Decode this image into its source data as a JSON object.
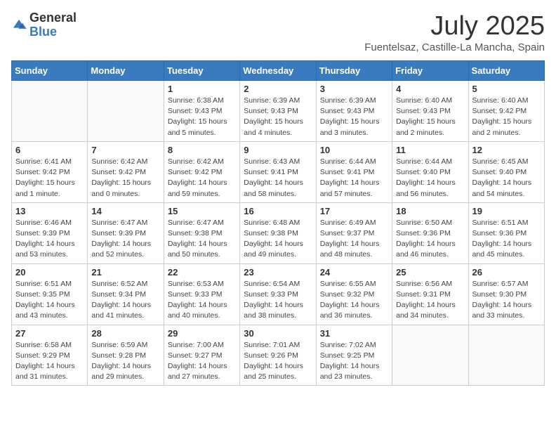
{
  "header": {
    "logo_general": "General",
    "logo_blue": "Blue",
    "month_title": "July 2025",
    "subtitle": "Fuentelsaz, Castille-La Mancha, Spain"
  },
  "weekdays": [
    "Sunday",
    "Monday",
    "Tuesday",
    "Wednesday",
    "Thursday",
    "Friday",
    "Saturday"
  ],
  "weeks": [
    [
      {
        "day": "",
        "info": ""
      },
      {
        "day": "",
        "info": ""
      },
      {
        "day": "1",
        "info": "Sunrise: 6:38 AM\nSunset: 9:43 PM\nDaylight: 15 hours\nand 5 minutes."
      },
      {
        "day": "2",
        "info": "Sunrise: 6:39 AM\nSunset: 9:43 PM\nDaylight: 15 hours\nand 4 minutes."
      },
      {
        "day": "3",
        "info": "Sunrise: 6:39 AM\nSunset: 9:43 PM\nDaylight: 15 hours\nand 3 minutes."
      },
      {
        "day": "4",
        "info": "Sunrise: 6:40 AM\nSunset: 9:43 PM\nDaylight: 15 hours\nand 2 minutes."
      },
      {
        "day": "5",
        "info": "Sunrise: 6:40 AM\nSunset: 9:42 PM\nDaylight: 15 hours\nand 2 minutes."
      }
    ],
    [
      {
        "day": "6",
        "info": "Sunrise: 6:41 AM\nSunset: 9:42 PM\nDaylight: 15 hours\nand 1 minute."
      },
      {
        "day": "7",
        "info": "Sunrise: 6:42 AM\nSunset: 9:42 PM\nDaylight: 15 hours\nand 0 minutes."
      },
      {
        "day": "8",
        "info": "Sunrise: 6:42 AM\nSunset: 9:42 PM\nDaylight: 14 hours\nand 59 minutes."
      },
      {
        "day": "9",
        "info": "Sunrise: 6:43 AM\nSunset: 9:41 PM\nDaylight: 14 hours\nand 58 minutes."
      },
      {
        "day": "10",
        "info": "Sunrise: 6:44 AM\nSunset: 9:41 PM\nDaylight: 14 hours\nand 57 minutes."
      },
      {
        "day": "11",
        "info": "Sunrise: 6:44 AM\nSunset: 9:40 PM\nDaylight: 14 hours\nand 56 minutes."
      },
      {
        "day": "12",
        "info": "Sunrise: 6:45 AM\nSunset: 9:40 PM\nDaylight: 14 hours\nand 54 minutes."
      }
    ],
    [
      {
        "day": "13",
        "info": "Sunrise: 6:46 AM\nSunset: 9:39 PM\nDaylight: 14 hours\nand 53 minutes."
      },
      {
        "day": "14",
        "info": "Sunrise: 6:47 AM\nSunset: 9:39 PM\nDaylight: 14 hours\nand 52 minutes."
      },
      {
        "day": "15",
        "info": "Sunrise: 6:47 AM\nSunset: 9:38 PM\nDaylight: 14 hours\nand 50 minutes."
      },
      {
        "day": "16",
        "info": "Sunrise: 6:48 AM\nSunset: 9:38 PM\nDaylight: 14 hours\nand 49 minutes."
      },
      {
        "day": "17",
        "info": "Sunrise: 6:49 AM\nSunset: 9:37 PM\nDaylight: 14 hours\nand 48 minutes."
      },
      {
        "day": "18",
        "info": "Sunrise: 6:50 AM\nSunset: 9:36 PM\nDaylight: 14 hours\nand 46 minutes."
      },
      {
        "day": "19",
        "info": "Sunrise: 6:51 AM\nSunset: 9:36 PM\nDaylight: 14 hours\nand 45 minutes."
      }
    ],
    [
      {
        "day": "20",
        "info": "Sunrise: 6:51 AM\nSunset: 9:35 PM\nDaylight: 14 hours\nand 43 minutes."
      },
      {
        "day": "21",
        "info": "Sunrise: 6:52 AM\nSunset: 9:34 PM\nDaylight: 14 hours\nand 41 minutes."
      },
      {
        "day": "22",
        "info": "Sunrise: 6:53 AM\nSunset: 9:33 PM\nDaylight: 14 hours\nand 40 minutes."
      },
      {
        "day": "23",
        "info": "Sunrise: 6:54 AM\nSunset: 9:33 PM\nDaylight: 14 hours\nand 38 minutes."
      },
      {
        "day": "24",
        "info": "Sunrise: 6:55 AM\nSunset: 9:32 PM\nDaylight: 14 hours\nand 36 minutes."
      },
      {
        "day": "25",
        "info": "Sunrise: 6:56 AM\nSunset: 9:31 PM\nDaylight: 14 hours\nand 34 minutes."
      },
      {
        "day": "26",
        "info": "Sunrise: 6:57 AM\nSunset: 9:30 PM\nDaylight: 14 hours\nand 33 minutes."
      }
    ],
    [
      {
        "day": "27",
        "info": "Sunrise: 6:58 AM\nSunset: 9:29 PM\nDaylight: 14 hours\nand 31 minutes."
      },
      {
        "day": "28",
        "info": "Sunrise: 6:59 AM\nSunset: 9:28 PM\nDaylight: 14 hours\nand 29 minutes."
      },
      {
        "day": "29",
        "info": "Sunrise: 7:00 AM\nSunset: 9:27 PM\nDaylight: 14 hours\nand 27 minutes."
      },
      {
        "day": "30",
        "info": "Sunrise: 7:01 AM\nSunset: 9:26 PM\nDaylight: 14 hours\nand 25 minutes."
      },
      {
        "day": "31",
        "info": "Sunrise: 7:02 AM\nSunset: 9:25 PM\nDaylight: 14 hours\nand 23 minutes."
      },
      {
        "day": "",
        "info": ""
      },
      {
        "day": "",
        "info": ""
      }
    ]
  ]
}
